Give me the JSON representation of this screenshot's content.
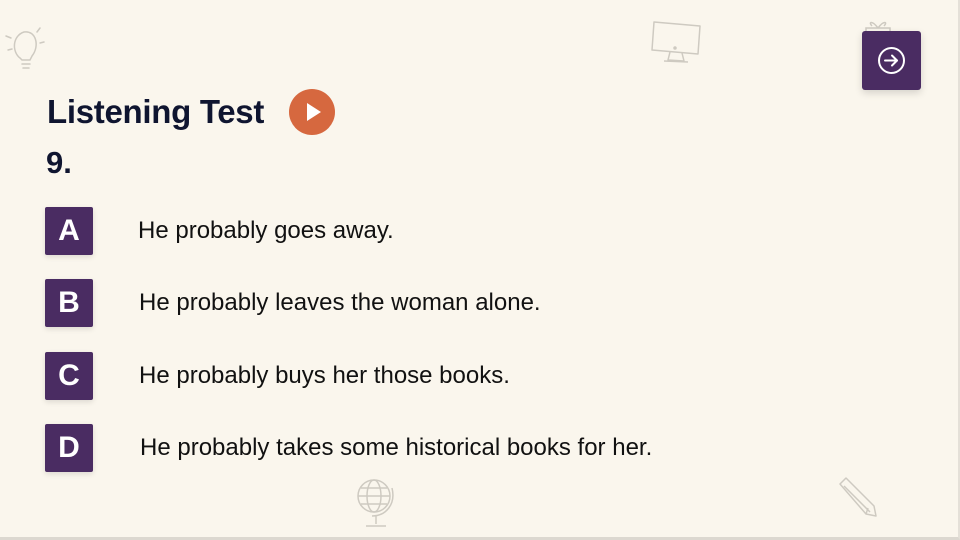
{
  "header": {
    "title": "Listening Test",
    "question_number": "9."
  },
  "options": [
    {
      "letter": "A",
      "text": "He probably goes away."
    },
    {
      "letter": "B",
      "text": "He probably leaves the woman alone."
    },
    {
      "letter": "C",
      "text": "He probably buys her those books."
    },
    {
      "letter": "D",
      "text": "He probably takes some historical books for her."
    }
  ],
  "icons": {
    "play": "play-icon",
    "next": "arrow-right-circle-icon",
    "decorations": [
      "lightbulb-icon",
      "monitor-icon",
      "gift-icon",
      "globe-icon",
      "pencil-icon"
    ]
  },
  "colors": {
    "background": "#faf6ed",
    "accent_purple": "#4a2c62",
    "accent_orange": "#d6683f",
    "title_text": "#0f1530"
  }
}
